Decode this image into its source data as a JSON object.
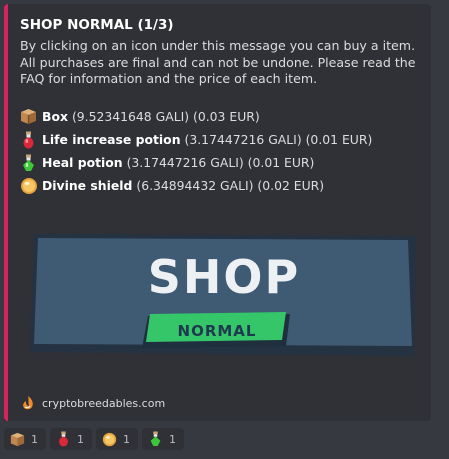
{
  "embed": {
    "accent_color": "#d4245e",
    "title": "SHOP NORMAL (1/3)",
    "description": "By clicking on an icon under this message you can buy a item. All purchases are final and can not be undone. Please read the FAQ for information and the price of each item.",
    "items": [
      {
        "icon": "box-icon",
        "name": "Box",
        "detail": "(9.52341648 GALI) (0.03 EUR)"
      },
      {
        "icon": "red-potion-icon",
        "name": "Life increase potion",
        "detail": "(3.17447216 GALI) (0.01 EUR)"
      },
      {
        "icon": "green-potion-icon",
        "name": "Heal potion",
        "detail": "(3.17447216 GALI) (0.01 EUR)"
      },
      {
        "icon": "divine-shield-icon",
        "name": "Divine shield",
        "detail": "(6.34894432 GALI) (0.02 EUR)"
      }
    ],
    "banner": {
      "main_text": "SHOP",
      "sub_text": "NORMAL"
    },
    "footer_text": "cryptobreedables.com"
  },
  "reactions": [
    {
      "icon": "box-icon",
      "count": "1"
    },
    {
      "icon": "red-potion-icon",
      "count": "1"
    },
    {
      "icon": "divine-shield-icon",
      "count": "1"
    },
    {
      "icon": "green-potion-icon",
      "count": "1"
    }
  ]
}
